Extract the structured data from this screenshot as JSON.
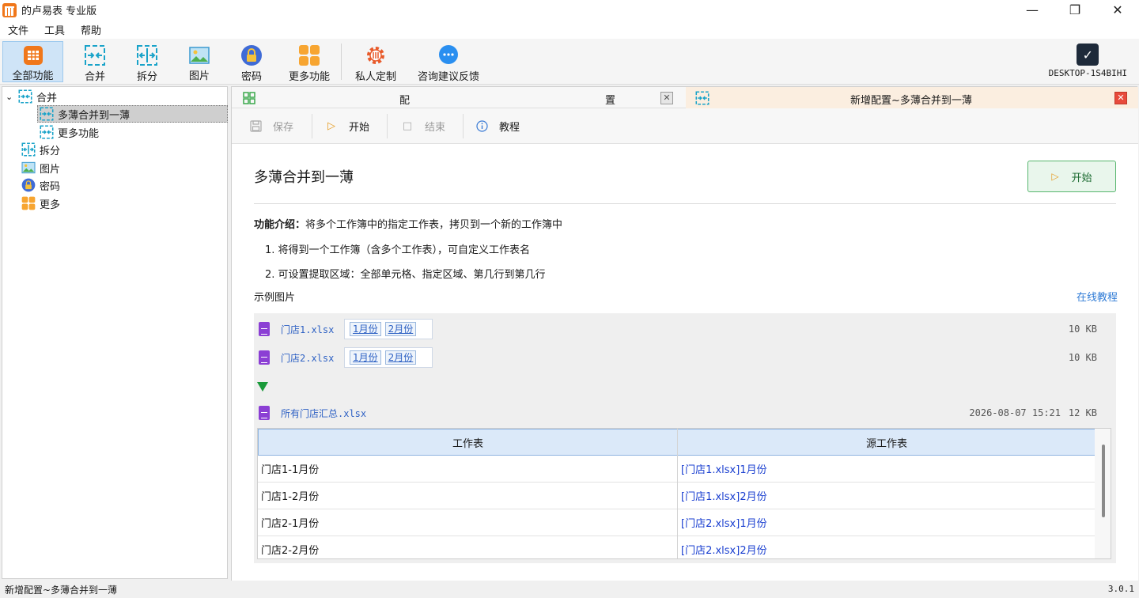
{
  "window": {
    "title": "的卢易表 专业版",
    "controls": {
      "minimize": "—",
      "maximize": "❐",
      "close": "✕"
    }
  },
  "menu": [
    "文件",
    "工具",
    "帮助"
  ],
  "toolbar": {
    "items": [
      {
        "label": "全部功能",
        "icon": "grid-app-icon",
        "active": true
      },
      {
        "label": "合并",
        "icon": "merge-icon"
      },
      {
        "label": "拆分",
        "icon": "split-icon"
      },
      {
        "label": "图片",
        "icon": "image-icon"
      },
      {
        "label": "密码",
        "icon": "lock-icon"
      },
      {
        "label": "更多功能",
        "icon": "more-apps-icon"
      },
      {
        "label": "私人定制",
        "icon": "custom-gear-icon"
      },
      {
        "label": "咨询建议反馈",
        "icon": "chat-icon"
      }
    ],
    "desktop": {
      "label": "DESKTOP-1S4BIHI",
      "icon": "check-icon"
    }
  },
  "tree": {
    "items": [
      {
        "label": "合并",
        "icon": "merge-icon",
        "expanded": true
      },
      {
        "label": "多薄合并到一薄",
        "icon": "merge-icon",
        "selected": true
      },
      {
        "label": "更多功能",
        "icon": "merge-icon"
      },
      {
        "label": "拆分",
        "icon": "split-icon"
      },
      {
        "label": "图片",
        "icon": "image-icon"
      },
      {
        "label": "密码",
        "icon": "lock-icon"
      },
      {
        "label": "更多",
        "icon": "more-apps-icon"
      }
    ]
  },
  "tabs": [
    {
      "label": "配                   置",
      "close": "✕"
    },
    {
      "label": "新增配置~多薄合并到一薄",
      "close": "✕",
      "active": true
    }
  ],
  "actions": {
    "save": "保存",
    "start": "开始",
    "stop": "结束",
    "tutorial": "教程"
  },
  "content": {
    "title": "多薄合并到一薄",
    "start_button": "开始",
    "intro_label": "功能介绍：",
    "intro_text": "将多个工作簿中的指定工作表，拷贝到一个新的工作簿中",
    "points": [
      "1. 将得到一个工作簿（含多个工作表），可自定义工作表名",
      "2. 可设置提取区域：全部单元格、指定区域、第几行到第几行"
    ],
    "example_label": "示例图片",
    "online_tutorial": "在线教程"
  },
  "demo": {
    "files": [
      {
        "name": "门店1.xlsx",
        "sheets": [
          "1月份",
          "2月份"
        ],
        "size": "10 KB"
      },
      {
        "name": "门店2.xlsx",
        "sheets": [
          "1月份",
          "2月份"
        ],
        "size": "10 KB"
      }
    ],
    "output": {
      "name": "所有门店汇总.xlsx",
      "date": "2026-08-07 15:21",
      "size": "12 KB"
    },
    "table": {
      "columns": [
        "工作表",
        "源工作表"
      ],
      "rows": [
        [
          "门店1-1月份",
          "[门店1.xlsx]1月份"
        ],
        [
          "门店1-2月份",
          "[门店1.xlsx]2月份"
        ],
        [
          "门店2-1月份",
          "[门店2.xlsx]1月份"
        ],
        [
          "门店2-2月份",
          "[门店2.xlsx]2月份"
        ]
      ]
    }
  },
  "status": {
    "left": "新增配置~多薄合并到一薄",
    "version": "3.0.1"
  }
}
